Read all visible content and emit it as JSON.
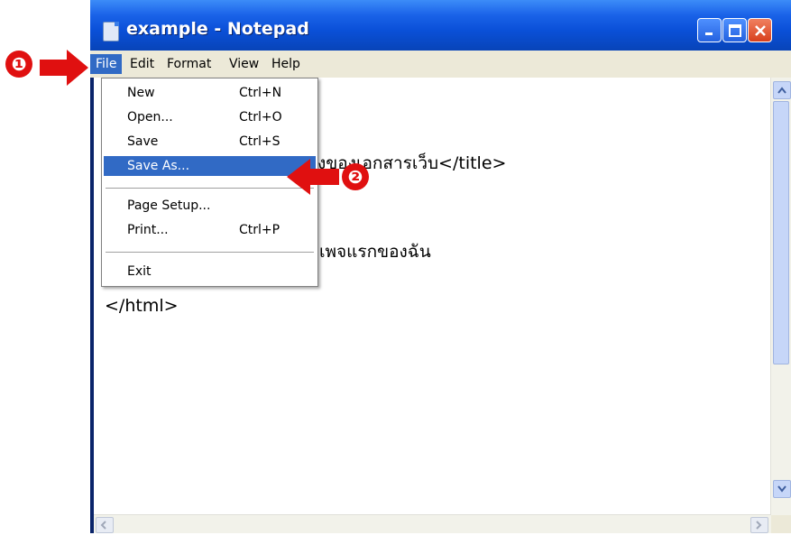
{
  "window": {
    "title": "example - Notepad",
    "controls": {
      "minimize": "minimize-icon",
      "maximize": "maximize-icon",
      "close": "close-icon"
    }
  },
  "menubar": {
    "items": [
      {
        "label": "File",
        "active": true
      },
      {
        "label": "Edit"
      },
      {
        "label": "Format"
      },
      {
        "label": "View"
      },
      {
        "label": "Help"
      }
    ]
  },
  "file_menu": {
    "items": [
      {
        "label": "New",
        "shortcut": "Ctrl+N"
      },
      {
        "label": "Open...",
        "shortcut": "Ctrl+O"
      },
      {
        "label": "Save",
        "shortcut": "Ctrl+S"
      },
      {
        "label": "Save As...",
        "shortcut": "",
        "highlighted": true
      },
      {
        "label": "Page Setup...",
        "shortcut": ""
      },
      {
        "label": "Print...",
        "shortcut": "Ctrl+P"
      },
      {
        "label": "Exit",
        "shortcut": ""
      }
    ]
  },
  "editor": {
    "visible_lines": [
      "งของเอกสารเว็บ</title>",
      "เพจแรกของฉัน",
      "</html>"
    ]
  },
  "annotations": {
    "step1": "❶",
    "step2": "❷",
    "color": "#e01010"
  },
  "colors": {
    "titlebar": "#0a50d8",
    "menu_highlight": "#316ac5",
    "menubar": "#ece9d8"
  }
}
